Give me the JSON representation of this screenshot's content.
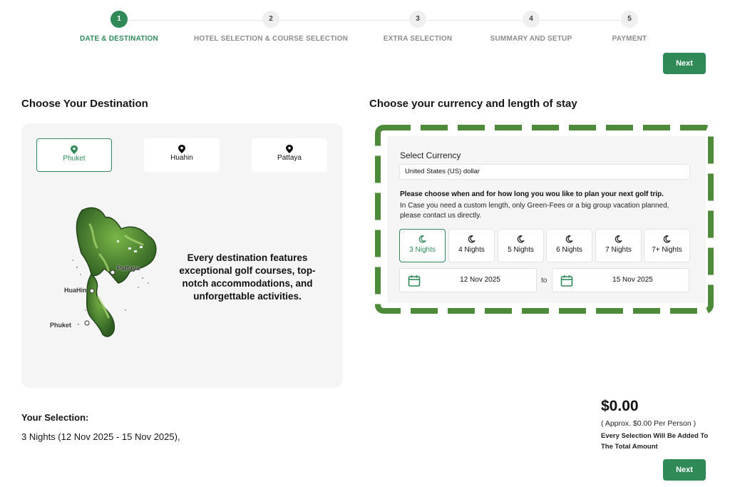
{
  "stepper": {
    "steps": [
      {
        "number": "1",
        "label": "DATE & DESTINATION",
        "active": true
      },
      {
        "number": "2",
        "label": "HOTEL SELECTION & COURSE SELECTION",
        "active": false
      },
      {
        "number": "3",
        "label": "EXTRA SELECTION",
        "active": false
      },
      {
        "number": "4",
        "label": "SUMMARY AND SETUP",
        "active": false
      },
      {
        "number": "5",
        "label": "PAYMENT",
        "active": false
      }
    ]
  },
  "next_label": "Next",
  "destination": {
    "title": "Choose Your Destination",
    "locations": [
      {
        "name": "Phuket",
        "selected": true
      },
      {
        "name": "Huahin",
        "selected": false
      },
      {
        "name": "Pattaya",
        "selected": false
      }
    ],
    "map_labels": {
      "huahin": "HuaHin",
      "pattaya": "Pattaya",
      "phuket": "Phuket"
    },
    "description": "Every destination features exceptional golf courses, top-notch accommodations, and unforgettable activities."
  },
  "currency": {
    "title": "Choose your currency and length of stay",
    "select_label": "Select Currency",
    "selected_currency": "United States (US) dollar",
    "question": "Please choose when and for how long you wou like to plan your next golf trip.",
    "note": "In Case you need a custom length, only Green-Fees or a big group vacation planned, please contact us directly.",
    "nights": [
      {
        "label": "3 Nights",
        "selected": true
      },
      {
        "label": "4 Nights",
        "selected": false
      },
      {
        "label": "5 Nights",
        "selected": false
      },
      {
        "label": "6 Nights",
        "selected": false
      },
      {
        "label": "7 Nights",
        "selected": false
      },
      {
        "label": "7+ Nights",
        "selected": false
      }
    ],
    "start_date": "12 Nov 2025",
    "to_label": "to",
    "end_date": "15 Nov 2025"
  },
  "selection": {
    "title": "Your Selection:",
    "text": "3 Nights (12 Nov 2025 - 15 Nov 2025),"
  },
  "price": {
    "total": "$0.00",
    "approx": "( Approx. $0.00 Per Person )",
    "note": "Every Selection Will Be Added To The Total Amount"
  },
  "colors": {
    "accent": "#2f8a58",
    "panel": "#f5f5f5",
    "dash": "#4d8a3a"
  },
  "icons": {
    "location": "map-pin-icon",
    "night": "moon-icon",
    "date": "calendar-icon"
  }
}
